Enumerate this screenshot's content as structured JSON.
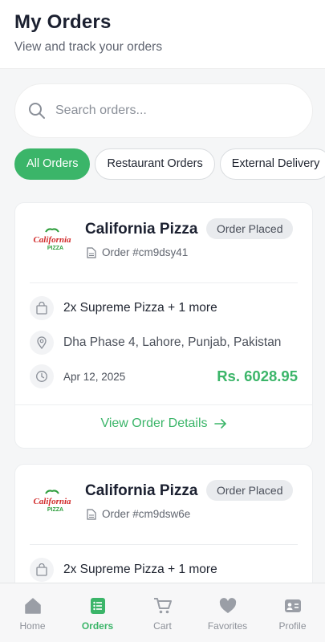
{
  "header": {
    "title": "My Orders",
    "subtitle": "View and track your orders"
  },
  "search": {
    "placeholder": "Search orders..."
  },
  "filters": [
    {
      "label": "All Orders",
      "active": true
    },
    {
      "label": "Restaurant Orders",
      "active": false
    },
    {
      "label": "External Delivery",
      "active": false
    }
  ],
  "orders": [
    {
      "restaurant": "California Pizza",
      "status": "Order Placed",
      "order_number": "Order #cm9dsy41",
      "items": "2x Supreme Pizza + 1 more",
      "address": "Dha Phase 4, Lahore, Punjab, Pakistan",
      "date": "Apr 12, 2025",
      "total": "Rs. 6028.95",
      "view_label": "View Order Details",
      "logo_text": "California PIZZA"
    },
    {
      "restaurant": "California Pizza",
      "status": "Order Placed",
      "order_number": "Order #cm9dsw6e",
      "items": "2x Supreme Pizza + 1 more",
      "logo_text": "California PIZZA"
    }
  ],
  "tabbar": [
    {
      "label": "Home",
      "icon": "home-icon",
      "active": false
    },
    {
      "label": "Orders",
      "icon": "orders-icon",
      "active": true
    },
    {
      "label": "Cart",
      "icon": "cart-icon",
      "active": false
    },
    {
      "label": "Favorites",
      "icon": "heart-icon",
      "active": false
    },
    {
      "label": "Profile",
      "icon": "profile-icon",
      "active": false
    }
  ],
  "colors": {
    "accent": "#3bb569",
    "badge_bg": "#e9ebee",
    "logo_red": "#d12a2a",
    "logo_green": "#2f9e3e"
  }
}
